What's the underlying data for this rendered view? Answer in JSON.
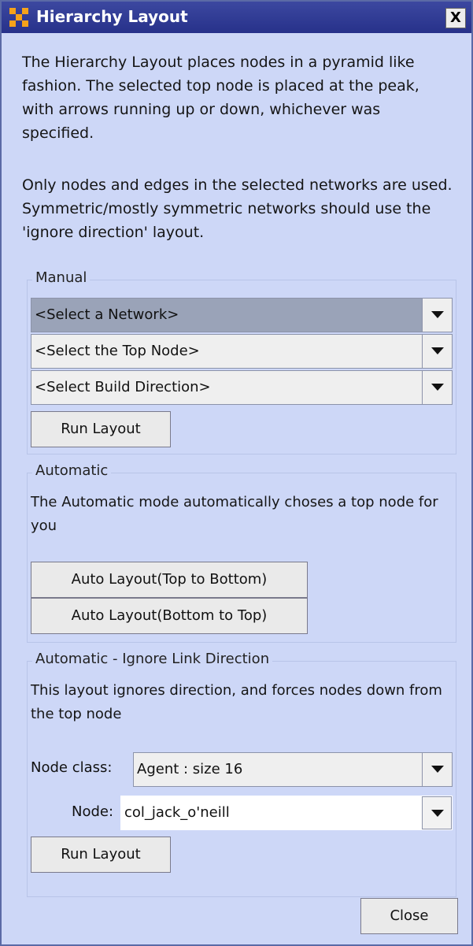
{
  "window": {
    "title": "Hierarchy Layout",
    "close_glyph": "X"
  },
  "description": {
    "para1": "The Hierarchy Layout places nodes in a pyramid like fashion. The selected top node is placed at the peak, with arrows running up or down, whichever was specified.",
    "para2": "Only nodes and edges in the selected networks are used. Symmetric/mostly symmetric networks should use the 'ignore direction' layout."
  },
  "manual": {
    "legend": "Manual",
    "network_select": "<Select a Network>",
    "top_node_select": "<Select the Top Node>",
    "direction_select": "<Select Build Direction>",
    "run_label": "Run Layout"
  },
  "automatic": {
    "legend": "Automatic",
    "note": "The Automatic mode automatically choses a top node for you",
    "top_to_bottom_label": "Auto Layout(Top to Bottom)",
    "bottom_to_top_label": "Auto Layout(Bottom to Top)"
  },
  "ignore_direction": {
    "legend": "Automatic - Ignore Link Direction",
    "note": "This layout ignores direction, and forces nodes down from the top node",
    "node_class_label": "Node class:",
    "node_class_value": "Agent : size 16",
    "node_label": "Node:",
    "node_value": "col_jack_o'neill",
    "run_label": "Run Layout"
  },
  "footer": {
    "close_label": "Close"
  },
  "colors": {
    "panel": "#cdd7f7",
    "titlebar": "#27318a",
    "accent_icon": "#f5a21a"
  }
}
